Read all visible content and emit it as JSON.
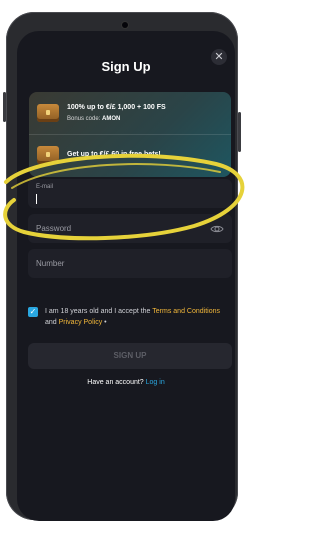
{
  "header": {
    "title": "Sign Up",
    "close_icon": "close-icon"
  },
  "promos": [
    {
      "icon": "treasure-chest-icon",
      "text": "100% up to €/£ 1,000 + 100 FS",
      "code_label": "Bonus code: ",
      "code": "AMON"
    },
    {
      "icon": "treasure-chest-icon",
      "text": "Get up to €/£ 60 in free bets!"
    }
  ],
  "form": {
    "email_label": "E-mail",
    "password_placeholder": "Password",
    "number_placeholder": "Number",
    "terms_prefix": "I am 18 years old and I accept the ",
    "terms_link": "Terms and Conditions",
    "terms_and": " and ",
    "privacy_link": "Privacy Policy",
    "terms_suffix": " •",
    "checked": true,
    "submit_label": "SIGN UP"
  },
  "footer": {
    "question": "Have an account? ",
    "login_link": "Log in"
  },
  "colors": {
    "accent_blue": "#2aa7e0",
    "accent_gold": "#f2b73a",
    "highlight": "#e6d23a"
  }
}
